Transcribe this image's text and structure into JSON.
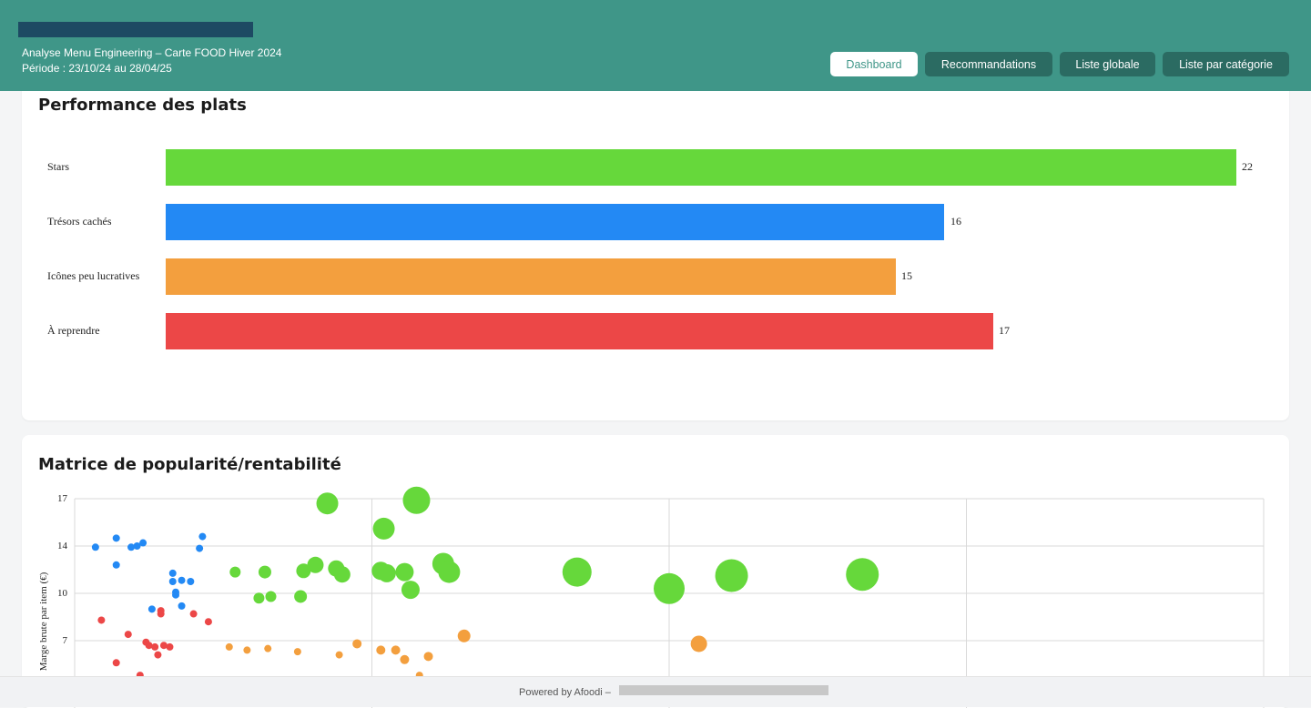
{
  "header": {
    "subtitle": "Analyse Menu Engineering – Carte FOOD Hiver 2024",
    "period": "Période : 23/10/24 au 28/04/25",
    "nav": [
      {
        "label": "Dashboard",
        "active": true
      },
      {
        "label": "Recommandations",
        "active": false
      },
      {
        "label": "Liste globale",
        "active": false
      },
      {
        "label": "Liste par catégorie",
        "active": false
      }
    ]
  },
  "performance": {
    "title": "Performance des plats",
    "bars": [
      {
        "label": "Stars",
        "value": 22,
        "color": "#66d83b"
      },
      {
        "label": "Trésors cachés",
        "value": 16,
        "color": "#2389f4"
      },
      {
        "label": "Icônes peu lucratives",
        "value": 15,
        "color": "#f39f3e"
      },
      {
        "label": "À reprendre",
        "value": 17,
        "color": "#ec4747"
      }
    ],
    "value_labels": [
      "22",
      "16",
      "15",
      "17"
    ]
  },
  "matrix": {
    "title": "Matrice de popularité/rentabilité",
    "ylabel": "Marge brute par item (€)",
    "y_ticks": [
      "17",
      "14",
      "10",
      "7"
    ]
  },
  "chart_data": {
    "type": "scatter",
    "title": "Matrice de popularité/rentabilité",
    "ylabel": "Marge brute par item (€)",
    "ylim": [
      5.5,
      17
    ],
    "xlim": [
      0,
      4
    ],
    "grid": true,
    "series": [
      {
        "name": "Stars",
        "color": "#66d83b",
        "points": [
          {
            "x": 0.54,
            "y": 11.8,
            "s": 10
          },
          {
            "x": 0.64,
            "y": 11.8,
            "s": 12
          },
          {
            "x": 0.62,
            "y": 9.7,
            "s": 10
          },
          {
            "x": 0.66,
            "y": 9.8,
            "s": 10
          },
          {
            "x": 0.76,
            "y": 9.8,
            "s": 12
          },
          {
            "x": 0.77,
            "y": 11.9,
            "s": 14
          },
          {
            "x": 0.81,
            "y": 12.4,
            "s": 16
          },
          {
            "x": 0.85,
            "y": 16.7,
            "s": 22
          },
          {
            "x": 0.88,
            "y": 12.1,
            "s": 16
          },
          {
            "x": 0.9,
            "y": 11.6,
            "s": 16
          },
          {
            "x": 1.03,
            "y": 11.9,
            "s": 18
          },
          {
            "x": 1.05,
            "y": 11.7,
            "s": 18
          },
          {
            "x": 1.04,
            "y": 15.1,
            "s": 22
          },
          {
            "x": 1.11,
            "y": 11.8,
            "s": 18
          },
          {
            "x": 1.13,
            "y": 10.3,
            "s": 18
          },
          {
            "x": 1.24,
            "y": 12.5,
            "s": 22
          },
          {
            "x": 1.26,
            "y": 11.8,
            "s": 22
          },
          {
            "x": 1.15,
            "y": 16.9,
            "s": 28
          },
          {
            "x": 1.69,
            "y": 11.8,
            "s": 30
          },
          {
            "x": 2.0,
            "y": 10.4,
            "s": 32
          },
          {
            "x": 2.21,
            "y": 11.5,
            "s": 34
          },
          {
            "x": 2.65,
            "y": 11.6,
            "s": 34
          }
        ]
      },
      {
        "name": "Trésors cachés",
        "color": "#2389f4",
        "points": [
          {
            "x": 0.07,
            "y": 13.9,
            "s": 6
          },
          {
            "x": 0.14,
            "y": 14.5,
            "s": 6
          },
          {
            "x": 0.14,
            "y": 12.4,
            "s": 6
          },
          {
            "x": 0.19,
            "y": 13.9,
            "s": 6
          },
          {
            "x": 0.21,
            "y": 14.0,
            "s": 6
          },
          {
            "x": 0.23,
            "y": 14.2,
            "s": 6
          },
          {
            "x": 0.26,
            "y": 9.0,
            "s": 6
          },
          {
            "x": 0.33,
            "y": 11.7,
            "s": 6
          },
          {
            "x": 0.33,
            "y": 11.0,
            "s": 6
          },
          {
            "x": 0.34,
            "y": 10.1,
            "s": 6
          },
          {
            "x": 0.34,
            "y": 9.9,
            "s": 6
          },
          {
            "x": 0.36,
            "y": 11.1,
            "s": 6
          },
          {
            "x": 0.36,
            "y": 9.2,
            "s": 6
          },
          {
            "x": 0.39,
            "y": 11.0,
            "s": 6
          },
          {
            "x": 0.42,
            "y": 13.8,
            "s": 6
          },
          {
            "x": 0.43,
            "y": 14.6,
            "s": 6
          }
        ]
      },
      {
        "name": "Icônes peu lucratives",
        "color": "#f39f3e",
        "points": [
          {
            "x": 0.52,
            "y": 6.6,
            "s": 6
          },
          {
            "x": 0.58,
            "y": 6.4,
            "s": 6
          },
          {
            "x": 0.65,
            "y": 6.5,
            "s": 6
          },
          {
            "x": 0.75,
            "y": 6.3,
            "s": 6
          },
          {
            "x": 0.89,
            "y": 6.1,
            "s": 6
          },
          {
            "x": 0.95,
            "y": 6.8,
            "s": 8
          },
          {
            "x": 1.03,
            "y": 6.4,
            "s": 8
          },
          {
            "x": 1.08,
            "y": 6.4,
            "s": 8
          },
          {
            "x": 1.11,
            "y": 5.8,
            "s": 8
          },
          {
            "x": 1.19,
            "y": 6.0,
            "s": 8
          },
          {
            "x": 1.31,
            "y": 7.3,
            "s": 12
          },
          {
            "x": 2.1,
            "y": 6.8,
            "s": 16
          },
          {
            "x": 1.16,
            "y": 4.8,
            "s": 6
          }
        ]
      },
      {
        "name": "À reprendre",
        "color": "#ec4747",
        "points": [
          {
            "x": 0.09,
            "y": 8.3,
            "s": 6
          },
          {
            "x": 0.14,
            "y": 5.6,
            "s": 6
          },
          {
            "x": 0.18,
            "y": 7.4,
            "s": 6
          },
          {
            "x": 0.22,
            "y": 4.8,
            "s": 6
          },
          {
            "x": 0.24,
            "y": 6.9,
            "s": 6
          },
          {
            "x": 0.25,
            "y": 6.7,
            "s": 6
          },
          {
            "x": 0.27,
            "y": 6.6,
            "s": 6
          },
          {
            "x": 0.28,
            "y": 6.1,
            "s": 6
          },
          {
            "x": 0.29,
            "y": 8.9,
            "s": 6
          },
          {
            "x": 0.29,
            "y": 8.7,
            "s": 6
          },
          {
            "x": 0.3,
            "y": 6.7,
            "s": 6
          },
          {
            "x": 0.32,
            "y": 6.6,
            "s": 6
          },
          {
            "x": 0.4,
            "y": 8.7,
            "s": 6
          },
          {
            "x": 0.45,
            "y": 8.2,
            "s": 6
          }
        ]
      }
    ]
  },
  "footer": {
    "text": "Powered by Afoodi –"
  }
}
